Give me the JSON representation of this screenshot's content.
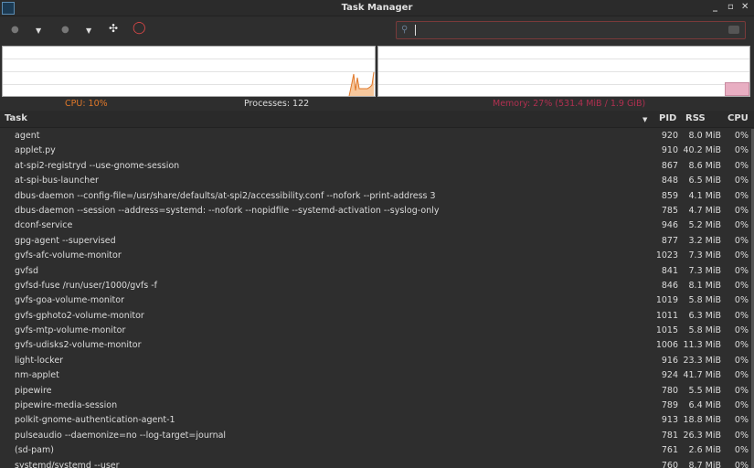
{
  "window": {
    "title": "Task Manager",
    "minimize": "_",
    "maximize": "▫",
    "close": "✕"
  },
  "toolbar": {
    "search_value": "",
    "search_placeholder": ""
  },
  "stats": {
    "cpu": "CPU: 10%",
    "processes": "Processes: 122",
    "memory": "Memory: 27% (531.4 MiB / 1.9 GiB)",
    "cpu_color": "#e0782a",
    "memory_color": "#b03050",
    "cpu_percent": 10,
    "memory_percent": 27
  },
  "columns": {
    "task": "Task",
    "pid": "PID",
    "rss": "RSS",
    "cpu": "CPU"
  },
  "rows": [
    {
      "task": "agent",
      "pid": "920",
      "rss": "8.0 MiB",
      "cpu": "0%"
    },
    {
      "task": "applet.py",
      "pid": "910",
      "rss": "40.2 MiB",
      "cpu": "0%"
    },
    {
      "task": "at-spi2-registryd --use-gnome-session",
      "pid": "867",
      "rss": "8.6 MiB",
      "cpu": "0%"
    },
    {
      "task": "at-spi-bus-launcher",
      "pid": "848",
      "rss": "6.5 MiB",
      "cpu": "0%"
    },
    {
      "task": "dbus-daemon --config-file=/usr/share/defaults/at-spi2/accessibility.conf --nofork --print-address 3",
      "pid": "859",
      "rss": "4.1 MiB",
      "cpu": "0%"
    },
    {
      "task": "dbus-daemon --session --address=systemd: --nofork --nopidfile --systemd-activation --syslog-only",
      "pid": "785",
      "rss": "4.7 MiB",
      "cpu": "0%"
    },
    {
      "task": "dconf-service",
      "pid": "946",
      "rss": "5.2 MiB",
      "cpu": "0%"
    },
    {
      "task": "gpg-agent --supervised",
      "pid": "877",
      "rss": "3.2 MiB",
      "cpu": "0%"
    },
    {
      "task": "gvfs-afc-volume-monitor",
      "pid": "1023",
      "rss": "7.3 MiB",
      "cpu": "0%"
    },
    {
      "task": "gvfsd",
      "pid": "841",
      "rss": "7.3 MiB",
      "cpu": "0%"
    },
    {
      "task": "gvfsd-fuse /run/user/1000/gvfs -f",
      "pid": "846",
      "rss": "8.1 MiB",
      "cpu": "0%"
    },
    {
      "task": "gvfs-goa-volume-monitor",
      "pid": "1019",
      "rss": "5.8 MiB",
      "cpu": "0%"
    },
    {
      "task": "gvfs-gphoto2-volume-monitor",
      "pid": "1011",
      "rss": "6.3 MiB",
      "cpu": "0%"
    },
    {
      "task": "gvfs-mtp-volume-monitor",
      "pid": "1015",
      "rss": "5.8 MiB",
      "cpu": "0%"
    },
    {
      "task": "gvfs-udisks2-volume-monitor",
      "pid": "1006",
      "rss": "11.3 MiB",
      "cpu": "0%"
    },
    {
      "task": "light-locker",
      "pid": "916",
      "rss": "23.3 MiB",
      "cpu": "0%"
    },
    {
      "task": "nm-applet",
      "pid": "924",
      "rss": "41.7 MiB",
      "cpu": "0%"
    },
    {
      "task": "pipewire",
      "pid": "780",
      "rss": "5.5 MiB",
      "cpu": "0%"
    },
    {
      "task": "pipewire-media-session",
      "pid": "789",
      "rss": "6.4 MiB",
      "cpu": "0%"
    },
    {
      "task": "polkit-gnome-authentication-agent-1",
      "pid": "913",
      "rss": "18.8 MiB",
      "cpu": "0%"
    },
    {
      "task": "pulseaudio --daemonize=no --log-target=journal",
      "pid": "781",
      "rss": "26.3 MiB",
      "cpu": "0%"
    },
    {
      "task": "(sd-pam)",
      "pid": "761",
      "rss": "2.6 MiB",
      "cpu": "0%"
    },
    {
      "task": "systemd/systemd --user",
      "pid": "760",
      "rss": "8.7 MiB",
      "cpu": "0%"
    }
  ]
}
